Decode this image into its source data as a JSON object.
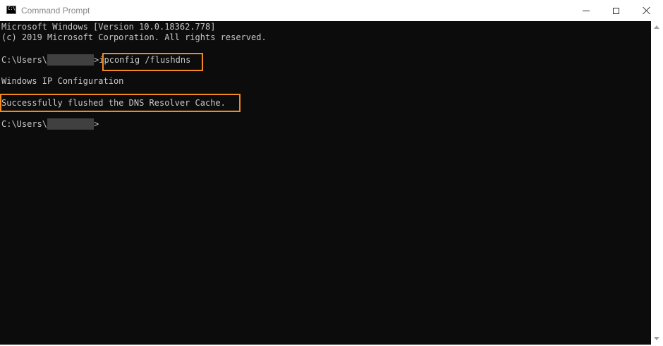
{
  "window": {
    "title": "Command Prompt",
    "app_icon_text": "C:\\."
  },
  "console": {
    "lines": [
      "Microsoft Windows [Version 10.0.18362.778]",
      "(c) 2019 Microsoft Corporation. All rights reserved.",
      "",
      "ipconfig /flushdns",
      "",
      "Windows IP Configuration",
      "",
      "Successfully flushed the DNS Resolver Cache.",
      "",
      ""
    ],
    "prompt_prefix": "C:\\Users\\",
    "prompt_suffix": ">",
    "command": "ipconfig /flushdns"
  },
  "colors": {
    "highlight": "#f28a1e",
    "console_bg": "#0c0c0c",
    "console_text": "#c8c8c8"
  }
}
